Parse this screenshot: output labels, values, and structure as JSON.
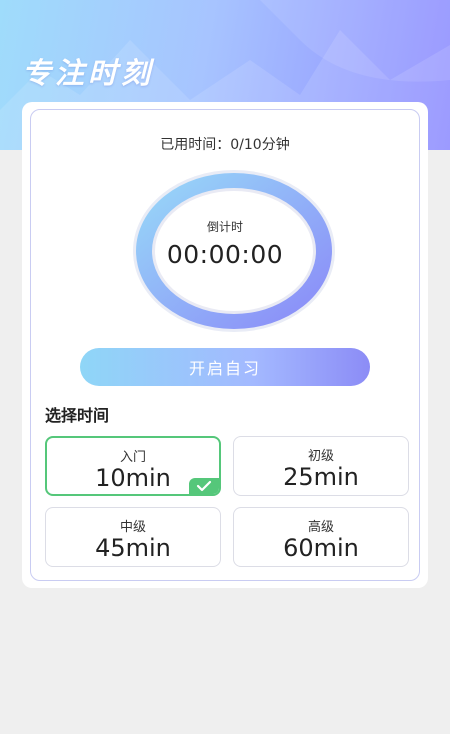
{
  "header": {
    "title": "专注时刻"
  },
  "timer": {
    "used_label": "已用时间：",
    "used_value": "0/10分钟",
    "countdown_label": "倒计时",
    "countdown_value": "00:00:00"
  },
  "start_button": {
    "label": "开启自习"
  },
  "select_time": {
    "title": "选择时间",
    "options": [
      {
        "level": "入门",
        "duration": "10min",
        "selected": true
      },
      {
        "level": "初级",
        "duration": "25min",
        "selected": false
      },
      {
        "level": "中级",
        "duration": "45min",
        "selected": false
      },
      {
        "level": "高级",
        "duration": "60min",
        "selected": false
      }
    ]
  },
  "colors": {
    "accent_green": "#55c77a",
    "gradient_start": "#8fd6f7",
    "gradient_end": "#8c8cf6",
    "background": "#efefef"
  }
}
